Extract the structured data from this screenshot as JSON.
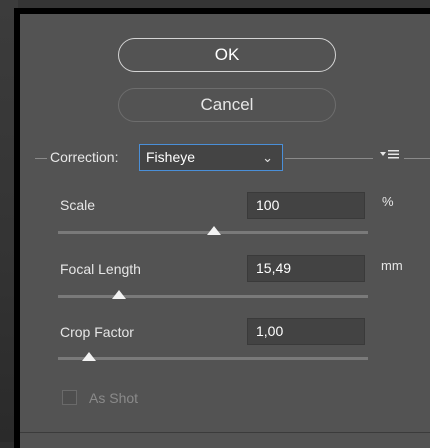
{
  "buttons": {
    "ok_label": "OK",
    "cancel_label": "Cancel"
  },
  "correction": {
    "label": "Correction:",
    "selected": "Fisheye",
    "chevron_icon": "chevron-down-icon",
    "menu_icon": "panel-menu-icon"
  },
  "settings": [
    {
      "label": "Scale",
      "value": "100",
      "unit": "%",
      "slider_level": 0.5
    },
    {
      "label": "Focal Length",
      "value": "15,49",
      "unit": "mm",
      "slider_level": 0.2
    },
    {
      "label": "Crop Factor",
      "value": "1,00",
      "unit": "",
      "slider_level": 0.1
    }
  ],
  "as_shot": {
    "label": "As Shot",
    "checked": false,
    "enabled": false
  },
  "colors": {
    "panel": "#535353",
    "accent_border": "#4a8fd8",
    "text": "#e6e6e6"
  }
}
